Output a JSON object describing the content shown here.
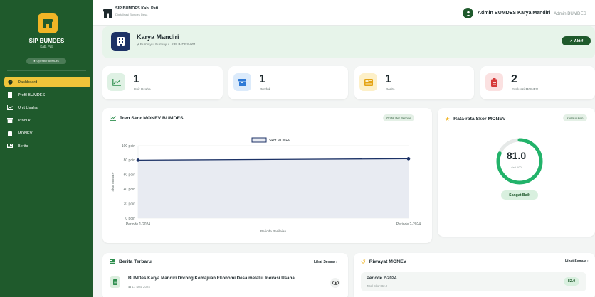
{
  "sidebar": {
    "brand": "SIP BUMDES",
    "brand_sub": "Kab. Pati",
    "role": "Operator BUMDes",
    "items": [
      {
        "label": "Dashboard",
        "icon": "dashboard-icon",
        "active": true
      },
      {
        "label": "Profil BUMDES",
        "icon": "building-icon"
      },
      {
        "label": "Unit Usaha",
        "icon": "chart-line-icon"
      },
      {
        "label": "Produk",
        "icon": "box-icon"
      },
      {
        "label": "MONEV",
        "icon": "clipboard-icon"
      },
      {
        "label": "Berita",
        "icon": "newspaper-icon"
      }
    ]
  },
  "topbar": {
    "title": "SIP BUMDES Kab. Pati",
    "subtitle": "Digitalisasi Bumdes Desa",
    "user_name": "Admin BUMDES Karya Mandiri",
    "user_role": "Admin BUMDES"
  },
  "org": {
    "name": "Karya Mandiri",
    "location": "Bumiayu, Bumiayu",
    "code": "BUMDES-001",
    "status": "Aktif"
  },
  "stats": [
    {
      "value": "1",
      "label": "Unit Usaha",
      "icon": "chart-line-icon",
      "bg": "#dff1e4",
      "fg": "#2f8f4f"
    },
    {
      "value": "1",
      "label": "Produk",
      "icon": "box-icon",
      "bg": "#dcebfb",
      "fg": "#2f7ad6"
    },
    {
      "value": "1",
      "label": "Berita",
      "icon": "newspaper-icon",
      "bg": "#fdf0c8",
      "fg": "#e4a416"
    },
    {
      "value": "2",
      "label": "Evaluasi MONEV",
      "icon": "clipboard-icon",
      "bg": "#fbe1e1",
      "fg": "#d63a3a"
    }
  ],
  "trend": {
    "title": "Tren Skor MONEV BUMDES",
    "chip": "Grafik Per Periode"
  },
  "chart_data": {
    "type": "area",
    "categories": [
      "Periode 1-2024",
      "Periode 2-2024"
    ],
    "series": [
      {
        "name": "Skor MONEV",
        "values": [
          80,
          82
        ]
      }
    ],
    "xlabel": "Periode Penilaian",
    "ylabel": "Skor MONEV",
    "ylim": [
      0,
      100
    ],
    "yticks": [
      0,
      20,
      40,
      60,
      80,
      100
    ],
    "ytick_labels": [
      "0 poin",
      "20 poin",
      "40 poin",
      "60 poin",
      "80 poin",
      "100 poin"
    ],
    "grid": true,
    "legend": "top-center"
  },
  "gauge": {
    "title": "Rata-rata Skor MONEV",
    "chip": "Keseluruhan",
    "value": "81.0",
    "value_num": 81,
    "max_label": "dari 100",
    "rating": "Sangat Baik",
    "color": "#22b36a"
  },
  "news": {
    "title": "Berita Terbaru",
    "link": "Lihat Semua",
    "items": [
      {
        "title": "BUMDes Karya Mandiri Dorong Kemajuan Ekonomi Desa melalui Inovasi Usaha",
        "date": "17 May 2024"
      }
    ]
  },
  "history": {
    "title": "Riwayat MONEV",
    "link": "Lihat Semua",
    "items": [
      {
        "period": "Periode 2-2024",
        "total": "Total Skor: 82.0",
        "score": "82.0"
      }
    ]
  }
}
